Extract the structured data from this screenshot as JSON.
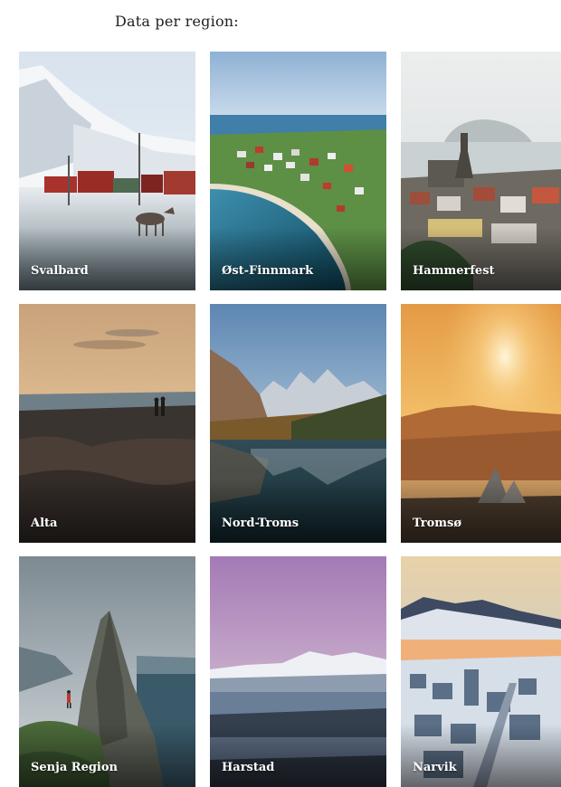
{
  "heading": "Data per region:",
  "regions": [
    {
      "label": "Svalbard"
    },
    {
      "label": "Øst-Finnmark"
    },
    {
      "label": "Hammerfest"
    },
    {
      "label": "Alta"
    },
    {
      "label": "Nord-Troms"
    },
    {
      "label": "Tromsø"
    },
    {
      "label": "Senja Region"
    },
    {
      "label": "Harstad"
    },
    {
      "label": "Narvik"
    }
  ]
}
